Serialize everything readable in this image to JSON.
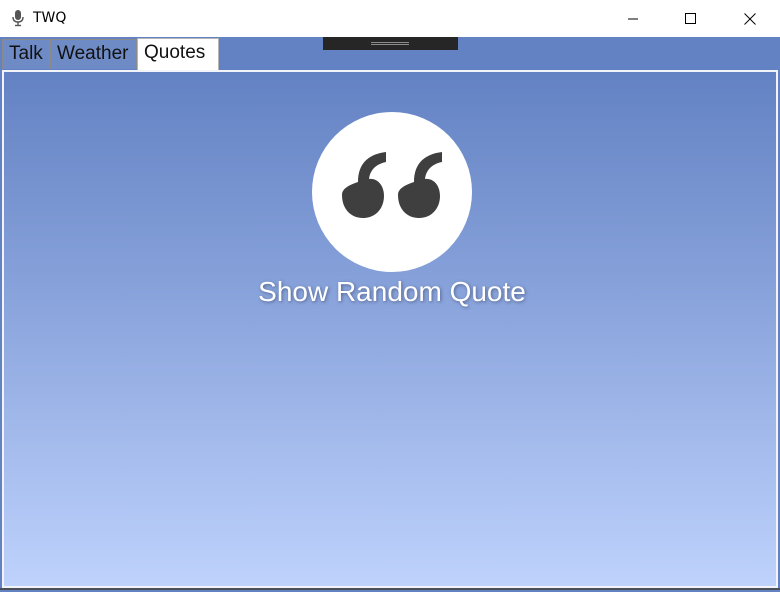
{
  "window": {
    "title": "TWQ",
    "app_icon": "microphone-icon",
    "controls": [
      "minimize-icon",
      "maximize-icon",
      "close-icon"
    ]
  },
  "tabs": [
    {
      "label": "Talk",
      "selected": false
    },
    {
      "label": "Weather",
      "selected": false
    },
    {
      "label": "Quotes",
      "selected": true
    }
  ],
  "quotes_page": {
    "icon": "quote-mark-icon",
    "button_label": "Show Random Quote"
  },
  "colors": {
    "accent": "#6382c3",
    "gradient_bottom": "#bed2fc",
    "icon_circle": "#ffffff",
    "icon_glyph": "#3f3f3f"
  }
}
